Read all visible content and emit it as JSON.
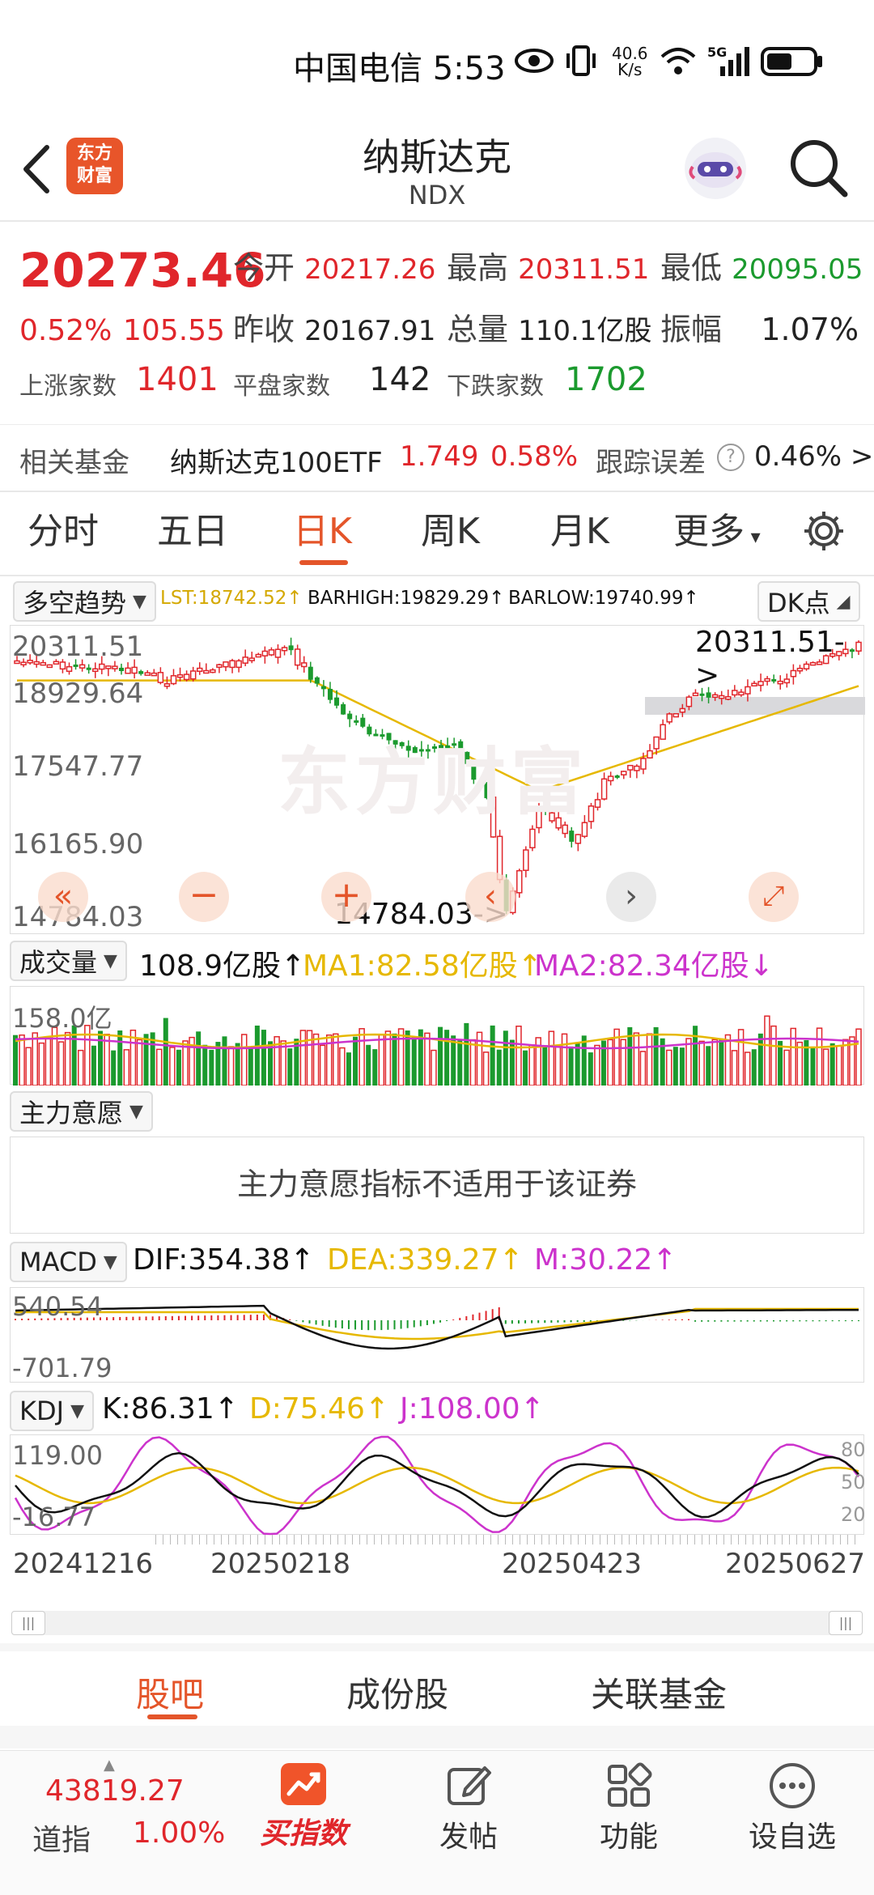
{
  "status_bar": {
    "carrier_time": "中国电信 5:53",
    "net_speed_value": "40.6",
    "net_speed_unit": "K/s",
    "network": "5G"
  },
  "header": {
    "title": "纳斯达克",
    "subtitle": "NDX",
    "logo_line1": "东方",
    "logo_line2": "财富"
  },
  "quote": {
    "price": "20273.46",
    "change_pct": "0.52%",
    "change_abs": "105.55",
    "open_label": "今开",
    "open": "20217.26",
    "high_label": "最高",
    "high": "20311.51",
    "low_label": "最低",
    "low": "20095.05",
    "prev_label": "昨收",
    "prev": "20167.91",
    "vol_label": "总量",
    "vol": "110.1亿股",
    "amp_label": "振幅",
    "amp": "1.07%",
    "up_label": "上涨家数",
    "up": "1401",
    "flat_label": "平盘家数",
    "flat": "142",
    "down_label": "下跌家数",
    "down": "1702"
  },
  "fund": {
    "label": "相关基金",
    "name": "纳斯达克100ETF",
    "price": "1.749",
    "pct": "0.58%",
    "err_label": "跟踪误差",
    "err": "0.46%",
    "arrow": ">"
  },
  "tabs": [
    "分时",
    "五日",
    "日K",
    "周K",
    "月K",
    "更多"
  ],
  "active_tab": "日K",
  "kline": {
    "indicator": "多空趋势",
    "lst": "LST:18742.52↑",
    "barhigh": "BARHIGH:19829.29↑",
    "barlow": "BARLOW:19740.99↑",
    "dk": "DK点",
    "y_labels": [
      "20311.51",
      "18929.64",
      "17547.77",
      "16165.90",
      "14784.03"
    ],
    "max_marker": "20311.51->",
    "min_marker": "14784.03->",
    "watermark": "东方财富"
  },
  "volume": {
    "label": "成交量",
    "value": "108.9亿股↑",
    "ma1": "MA1:82.58亿股↑",
    "ma2": "MA2:82.34亿股↓",
    "y_top": "158.0亿"
  },
  "zlyy": {
    "label": "主力意愿",
    "message": "主力意愿指标不适用于该证券"
  },
  "macd": {
    "label": "MACD",
    "dif": "DIF:354.38↑",
    "dea": "DEA:339.27↑",
    "m": "M:30.22↑",
    "y_top": "540.54",
    "y_bottom": "-701.79"
  },
  "kdj": {
    "label": "KDJ",
    "k": "K:86.31↑",
    "d": "D:75.46↑",
    "j": "J:108.00↑",
    "y_top": "119.00",
    "y_bottom": "-16.77",
    "r80": "80",
    "r50": "50",
    "r20": "20"
  },
  "dates": [
    "20241216",
    "20250218",
    "20250423",
    "20250627"
  ],
  "bottom_tabs": [
    "股吧",
    "成份股",
    "关联基金"
  ],
  "bottom_nav": {
    "dji_value": "43819.27",
    "dji_name": "道指",
    "dji_pct": "1.00%",
    "items": [
      "买指数",
      "发帖",
      "功能",
      "设自选"
    ]
  },
  "colors": {
    "up": "#e0262b",
    "down": "#1b9a2e",
    "accent": "#e4552a",
    "ma_yellow": "#e6b800",
    "ma_purple": "#cc33cc"
  }
}
